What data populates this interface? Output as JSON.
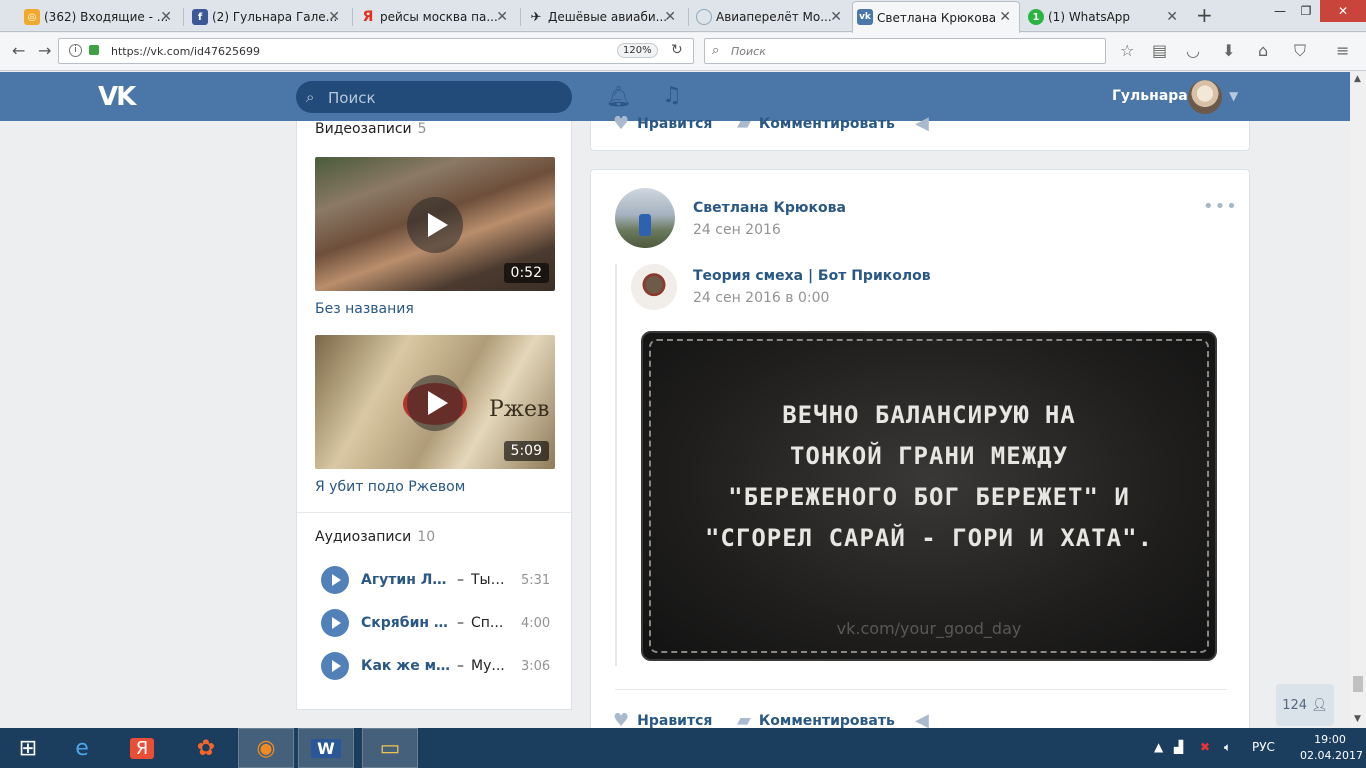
{
  "browser": {
    "tabs": [
      {
        "title": "(362) Входящие - ...",
        "favicon_color": "#f2a82b",
        "favicon_glyph": "◎",
        "active": false
      },
      {
        "title": "(2) Гульнара Гале...",
        "favicon_color": "#3b5998",
        "favicon_glyph": "f",
        "active": false
      },
      {
        "title": "рейсы москва па...",
        "favicon_color": "#ffffff",
        "favicon_glyph": "Я",
        "active": false
      },
      {
        "title": "Дешёвые авиаби...",
        "favicon_color": "#ffffff",
        "favicon_glyph": "✈",
        "active": false
      },
      {
        "title": "Авиаперелёт Мо...",
        "favicon_color": "#ffffff",
        "favicon_glyph": "◌",
        "active": false
      },
      {
        "title": "Светлана Крюкова",
        "favicon_color": "#4a76a8",
        "favicon_glyph": "vk",
        "active": true
      },
      {
        "title": "(1) WhatsApp",
        "favicon_color": "#2ab540",
        "favicon_glyph": "1",
        "active": false
      }
    ],
    "url": "https://vk.com/id47625699",
    "url_host": "vk.com",
    "zoom": "120%",
    "search_placeholder": "Поиск"
  },
  "vk": {
    "search_placeholder": "Поиск",
    "user_name": "Гульнара",
    "brand_color": "#4a76a8"
  },
  "sidebar": {
    "videos_title": "Видеозаписи",
    "videos_count": "5",
    "videos": [
      {
        "title": "Без названия",
        "duration": "0:52"
      },
      {
        "title": "Я убит подо Ржевом",
        "duration": "5:09",
        "overlay_text": "Ржев"
      }
    ],
    "audio_title": "Аудиозаписи",
    "audio_count": "10",
    "audio": [
      {
        "artist": "Агутин Ле...",
        "dash": "–",
        "title": "Ты ...",
        "duration": "5:31"
      },
      {
        "artist": "Скрябин К...",
        "dash": "–",
        "title": "Сп...",
        "duration": "4:00"
      },
      {
        "artist": "Как же ма...",
        "dash": "–",
        "title": "Му...",
        "duration": "3:06"
      }
    ]
  },
  "prev_post": {
    "like_label": "Нравится",
    "comment_label": "Комментировать"
  },
  "post": {
    "author": "Светлана Крюкова",
    "date": "24 сен 2016",
    "repost": {
      "author": "Теория смеха | Бот Приколов",
      "date": "24 сен 2016 в 0:00"
    },
    "image_text": [
      "ВЕЧНО БАЛАНСИРУЮ НА",
      "ТОНКОЙ ГРАНИ МЕЖДУ",
      "\"БЕРЕЖЕНОГО БОГ БЕРЕЖЕТ\" И",
      "\"СГОРЕЛ САРАЙ - ГОРИ И ХАТА\"."
    ],
    "image_watermark": "vk.com/your_good_day",
    "like_label": "Нравится",
    "comment_label": "Комментировать"
  },
  "online_count": "124",
  "taskbar": {
    "lang": "РУС",
    "time": "19:00",
    "date": "02.04.2017"
  }
}
